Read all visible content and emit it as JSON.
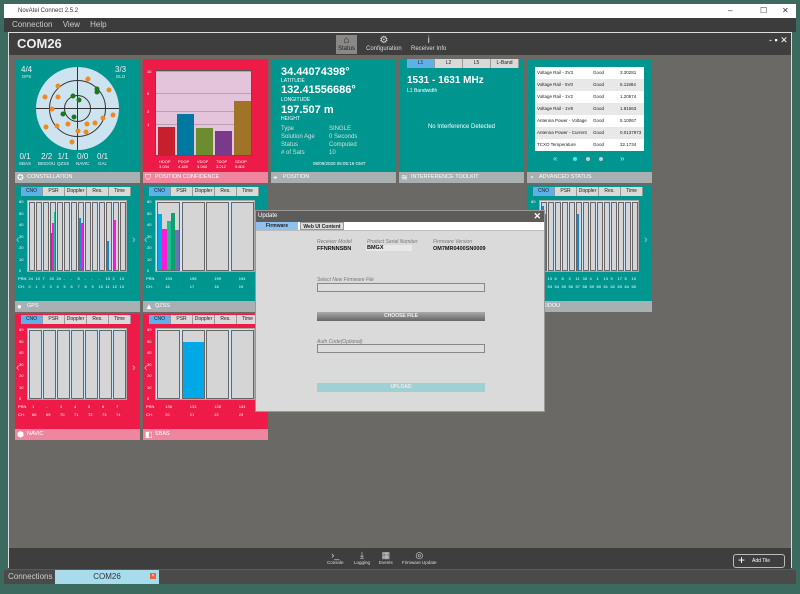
{
  "app": {
    "title": "NovAtel Connect 2.5.2",
    "menu": [
      "Connection",
      "View",
      "Help"
    ]
  },
  "header": {
    "title": "COM26",
    "nav": [
      {
        "label": "Status",
        "icon": "home-icon"
      },
      {
        "label": "Configuration",
        "icon": "gear-icon"
      },
      {
        "label": "Receiver Info",
        "icon": "info-icon"
      }
    ]
  },
  "constellation": {
    "label": "CONSTELLATION",
    "counts": [
      {
        "name": "GPS",
        "val": "4/4"
      },
      {
        "name": "GLO",
        "val": "3/3"
      },
      {
        "name": "SBAS",
        "val": "0/1"
      },
      {
        "name": "BEIDOU",
        "val": "2/2"
      },
      {
        "name": "QZSS",
        "val": "1/1"
      },
      {
        "name": "NAVIC",
        "val": "0/0"
      },
      {
        "name": "GAL",
        "val": "0/1"
      }
    ],
    "sats": [
      {
        "az": 20,
        "el": 20,
        "c": "#f08a1a"
      },
      {
        "az": 60,
        "el": 10,
        "c": "#f08a1a"
      },
      {
        "az": 45,
        "el": 30,
        "c": "#1a7a1a"
      },
      {
        "az": 50,
        "el": 35,
        "c": "#1a7a1a"
      },
      {
        "az": 300,
        "el": 40,
        "c": "#f08a1a"
      },
      {
        "az": 320,
        "el": 25,
        "c": "#f08a1a"
      },
      {
        "az": 340,
        "el": 60,
        "c": "#1a7a1a"
      },
      {
        "az": 10,
        "el": 70,
        "c": "#1a7a1a"
      },
      {
        "az": 200,
        "el": 70,
        "c": "#1a7a1a"
      },
      {
        "az": 250,
        "el": 55,
        "c": "#1a7a1a"
      },
      {
        "az": 270,
        "el": 35,
        "c": "#f08a1a"
      },
      {
        "az": 230,
        "el": 30,
        "c": "#f08a1a"
      },
      {
        "az": 210,
        "el": 50,
        "c": "#f08a1a"
      },
      {
        "az": 180,
        "el": 40,
        "c": "#f08a1a"
      },
      {
        "az": 160,
        "el": 35,
        "c": "#f08a1a"
      },
      {
        "az": 150,
        "el": 50,
        "c": "#f08a1a"
      },
      {
        "az": 130,
        "el": 40,
        "c": "#f08a1a"
      },
      {
        "az": 190,
        "el": 15,
        "c": "#f08a1a"
      },
      {
        "az": 240,
        "el": 10,
        "c": "#f08a1a"
      },
      {
        "az": 100,
        "el": 10,
        "c": "#f08a1a"
      },
      {
        "az": 110,
        "el": 30,
        "c": "#f08a1a"
      },
      {
        "az": 290,
        "el": 15,
        "c": "#f08a1a"
      }
    ]
  },
  "dop": {
    "label": "POSITION CONFIDENCE",
    "yticks": [
      "10",
      "5",
      "3",
      "1"
    ],
    "bars": [
      {
        "name": "HDOP",
        "val": "3.034",
        "v": 3.034,
        "c": "#c71f2e"
      },
      {
        "name": "PDOP",
        "val": "4.480",
        "v": 4.48,
        "c": "#0078a0"
      },
      {
        "name": "VDOP",
        "val": "3.040",
        "v": 2.9,
        "c": "#6c8c30"
      },
      {
        "name": "TDOP",
        "val": "3.212",
        "v": 2.6,
        "c": "#7a3a8c"
      },
      {
        "name": "GDOP",
        "val": "5.801",
        "v": 5.8,
        "c": "#a07428"
      }
    ]
  },
  "position": {
    "label": "POSITION",
    "lat": "34.44074398°",
    "lat_label": "LATITUDE",
    "lon": "132.41556686°",
    "lon_label": "LONGITUDE",
    "height": "197.507 m",
    "height_label": "HEIGHT",
    "rows": [
      [
        "Type",
        "SINGLE"
      ],
      [
        "Solution Age",
        "0 Seconds"
      ],
      [
        "Status",
        "Computed"
      ],
      [
        "# of Sats",
        "10"
      ]
    ],
    "time": "08/09/2020 06:05:19 GMT"
  },
  "interference": {
    "label": "INTERFERENCE TOOLKIT",
    "bands": [
      "L1",
      "L2",
      "L5",
      "L-Band"
    ],
    "range": "1531 - 1631 MHz",
    "range_label": "L1 Bandwidth",
    "status": "No Interference Detected"
  },
  "advanced": {
    "label": "ADVANCED STATUS",
    "rows": [
      [
        "Voltage Rail - 3V3",
        "Good",
        "3.30281"
      ],
      [
        "Voltage Rail - 5V0",
        "Good",
        "5.11884"
      ],
      [
        "Voltage Rail - 1V2",
        "Good",
        "1.20574"
      ],
      [
        "Voltage Rail - 1V8",
        "Good",
        "1.81563"
      ],
      [
        "Antenna Power - Voltage",
        "Good",
        "5.10067"
      ],
      [
        "Antenna Power - Current",
        "Good",
        "0.0137973"
      ],
      [
        "TCXO Temperature",
        "Good",
        "32.1734"
      ]
    ]
  },
  "cno_tabs": [
    "CNO",
    "PSR",
    "Doppler",
    "Res.",
    "Time"
  ],
  "yaxis": [
    "60",
    "50",
    "40",
    "30",
    "20",
    "10",
    "0"
  ],
  "trackers": [
    {
      "label": "GPS",
      "icon": "circle-icon",
      "theme": "teal",
      "pin_label": "PRN",
      "ch_label": "CH.",
      "prn": [
        "24",
        "10",
        "7",
        "20",
        "24",
        "-",
        "-",
        "5",
        "-",
        "-",
        "-",
        "15",
        "2",
        "13"
      ],
      "ch": [
        "0",
        "1",
        "2",
        "3",
        "4",
        "5",
        "6",
        "7",
        "8",
        "9",
        "10",
        "11",
        "12",
        "13"
      ],
      "bars": [
        [],
        [],
        [],
        [
          [
            32,
            "#7a3fb0"
          ],
          [
            40,
            "#ff1ad9"
          ],
          [
            50,
            "#19c28a"
          ]
        ],
        [],
        [],
        [],
        [
          [
            45,
            "#1a88d0"
          ],
          [
            40,
            "#ff1ad9"
          ]
        ],
        [],
        [],
        [],
        [
          [
            25,
            "#1a88d0"
          ]
        ],
        [
          [
            43,
            "#ff1ad9"
          ]
        ],
        []
      ]
    },
    {
      "label": "QZSS",
      "icon": "triangle-icon",
      "theme": "teal",
      "pin_label": "PRN",
      "ch_label": "CH.",
      "prn": [
        "193",
        "195",
        "199",
        "194"
      ],
      "ch": [
        "16",
        "17",
        "18",
        "19"
      ],
      "bars": [
        [
          [
            48,
            "#00a8e8"
          ],
          [
            35,
            "#ff1ad9"
          ],
          [
            42,
            "#19c28a"
          ],
          [
            49,
            "#10a070"
          ],
          [
            34,
            "#7070b8"
          ]
        ],
        [],
        [],
        []
      ]
    },
    {
      "label": "NAVIC",
      "icon": "hexagon-icon",
      "theme": "red",
      "pin_label": "PRN",
      "ch_label": "CH.",
      "prn": [
        "1",
        "-",
        "3",
        "4",
        "5",
        "6",
        "7"
      ],
      "ch": [
        "68",
        "69",
        "70",
        "71",
        "72",
        "73",
        "74"
      ],
      "bars": [
        [],
        [],
        [],
        [],
        [],
        [],
        []
      ]
    },
    {
      "label": "SBAS",
      "icon": "sbas-icon",
      "theme": "red",
      "pin_label": "PRN",
      "ch_label": "CH.",
      "prn": [
        "136",
        "133",
        "135",
        "134"
      ],
      "ch": [
        "20",
        "21",
        "22",
        "23"
      ],
      "bars": [
        [],
        [
          [
            48,
            "#00a8e8"
          ]
        ],
        [],
        []
      ]
    },
    {
      "label": "BEIDOU",
      "icon": "beidou-icon",
      "theme": "teal",
      "pin_label": "",
      "ch_label": "",
      "prn": [
        "3",
        "13",
        "6",
        "8",
        "3",
        "11",
        "33",
        "4",
        "1",
        "13",
        "9",
        "17",
        "5",
        "10"
      ],
      "ch": [
        "52",
        "53",
        "54",
        "55",
        "56",
        "57",
        "58",
        "59",
        "60",
        "61",
        "62",
        "63",
        "64",
        "65"
      ],
      "bars": [
        [
          [
            55,
            "#1a88d0"
          ],
          [
            48,
            "#ff1ad9"
          ]
        ],
        [],
        [],
        [],
        [],
        [
          [
            48,
            "#1a88d0"
          ]
        ],
        [],
        [],
        [],
        [],
        [],
        [],
        [],
        []
      ]
    }
  ],
  "dialog": {
    "title": "Update",
    "tabs": [
      "Firmware",
      "Web UI Content"
    ],
    "model_label": "Receiver Model",
    "model": "FFNRNNSBN",
    "serial_label": "Product Serial Number",
    "serial": "BMGX",
    "fw_label": "Firmware Version",
    "fw": "OM7MR0400SN0009",
    "file_label": "Select New Firmware File",
    "choose": "CHOOSE FILE",
    "auth_label": "Auth Code(Optional)",
    "upload": "UPLOAD"
  },
  "toolbar": [
    {
      "label": "Console",
      "icon": "console-icon",
      "g": "›_"
    },
    {
      "label": "Logging",
      "icon": "download-icon",
      "g": "⤓"
    },
    {
      "label": "Events",
      "icon": "calendar-icon",
      "g": "▦"
    },
    {
      "label": "Firmware Update",
      "icon": "firmware-icon",
      "g": "◎"
    }
  ],
  "add_tile": "Add Tile",
  "connections": {
    "label": "Connections",
    "tab": "COM26"
  }
}
